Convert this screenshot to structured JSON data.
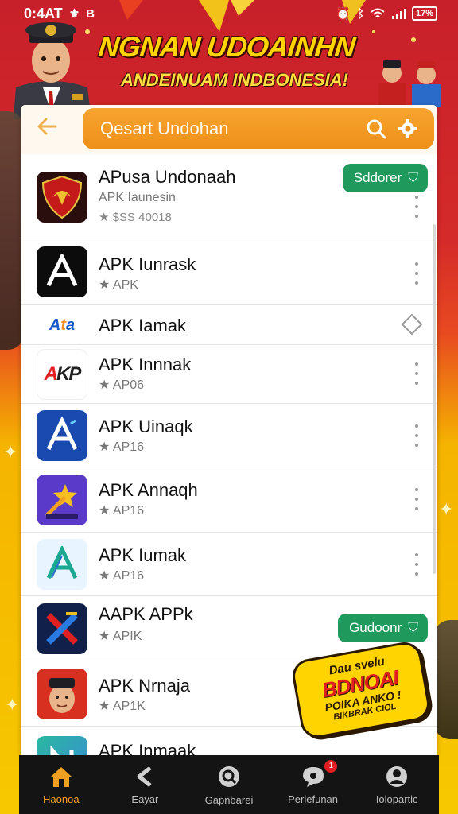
{
  "status_bar": {
    "time": "0:4AT",
    "left_icons": "B",
    "battery": "17%"
  },
  "banner": {
    "title": "NGNAN UDOAINHN",
    "subtitle": "ANDEINUAM INDBONESIA!"
  },
  "search": {
    "placeholder": "Qesart Undohan",
    "back_icon": "arrow-left-icon",
    "colors": {
      "bar": "#f39a20",
      "accent": "#1f9a5c"
    }
  },
  "apps": [
    {
      "name": "APusa Undonaah",
      "sub": "APK Iaunesin",
      "sub2": "★ $SS 40018",
      "action": "Sddorer",
      "icon": "emblem-icon"
    },
    {
      "name": "APK Iunrask",
      "sub": "★ APK",
      "sub2": "",
      "action": "",
      "icon": "a-logo-icon"
    },
    {
      "name": "APK Iamak",
      "sub": "",
      "sub2": "",
      "action": "",
      "icon": "apk-text-logo-icon"
    },
    {
      "name": "APK Innnak",
      "sub": "★ AP06",
      "sub2": "",
      "action": "",
      "icon": "akp-logo-icon"
    },
    {
      "name": "APK Uinaqk",
      "sub": "★ AP16",
      "sub2": "",
      "action": "",
      "icon": "blue-a-logo-icon"
    },
    {
      "name": "APK Annaqh",
      "sub": "★ AP16",
      "sub2": "",
      "action": "",
      "icon": "star-badge-icon"
    },
    {
      "name": "APK Iumak",
      "sub": "★ AP16",
      "sub2": "",
      "action": "",
      "icon": "teal-a-logo-icon"
    },
    {
      "name": "AAPK APPk",
      "sub": "★ APIK",
      "sub2": "",
      "action": "Gudoonr",
      "icon": "x-logo-icon"
    },
    {
      "name": "APK Nrnaja",
      "sub": "★ AP1K",
      "sub2": "",
      "action": "",
      "icon": "officer-avatar-icon"
    },
    {
      "name": "APK Inmaak",
      "sub": "",
      "sub2": "",
      "action": "",
      "icon": "green-logo-icon"
    }
  ],
  "promo": {
    "line1": "Dau svelu",
    "line2": "BDNOAI",
    "line3": "POIKA ANKO !",
    "line4": "BIKBRAK CIOL"
  },
  "nav": [
    {
      "label": "Haonoa",
      "icon": "home-icon",
      "active": true
    },
    {
      "label": "Eayar",
      "icon": "back-arrow-icon",
      "active": false
    },
    {
      "label": "Gapnbarei",
      "icon": "search-circle-icon",
      "active": false
    },
    {
      "label": "Perlefunan",
      "icon": "chat-icon",
      "active": false,
      "badge": "1"
    },
    {
      "label": "Iolopartic",
      "icon": "profile-icon",
      "active": false
    }
  ]
}
